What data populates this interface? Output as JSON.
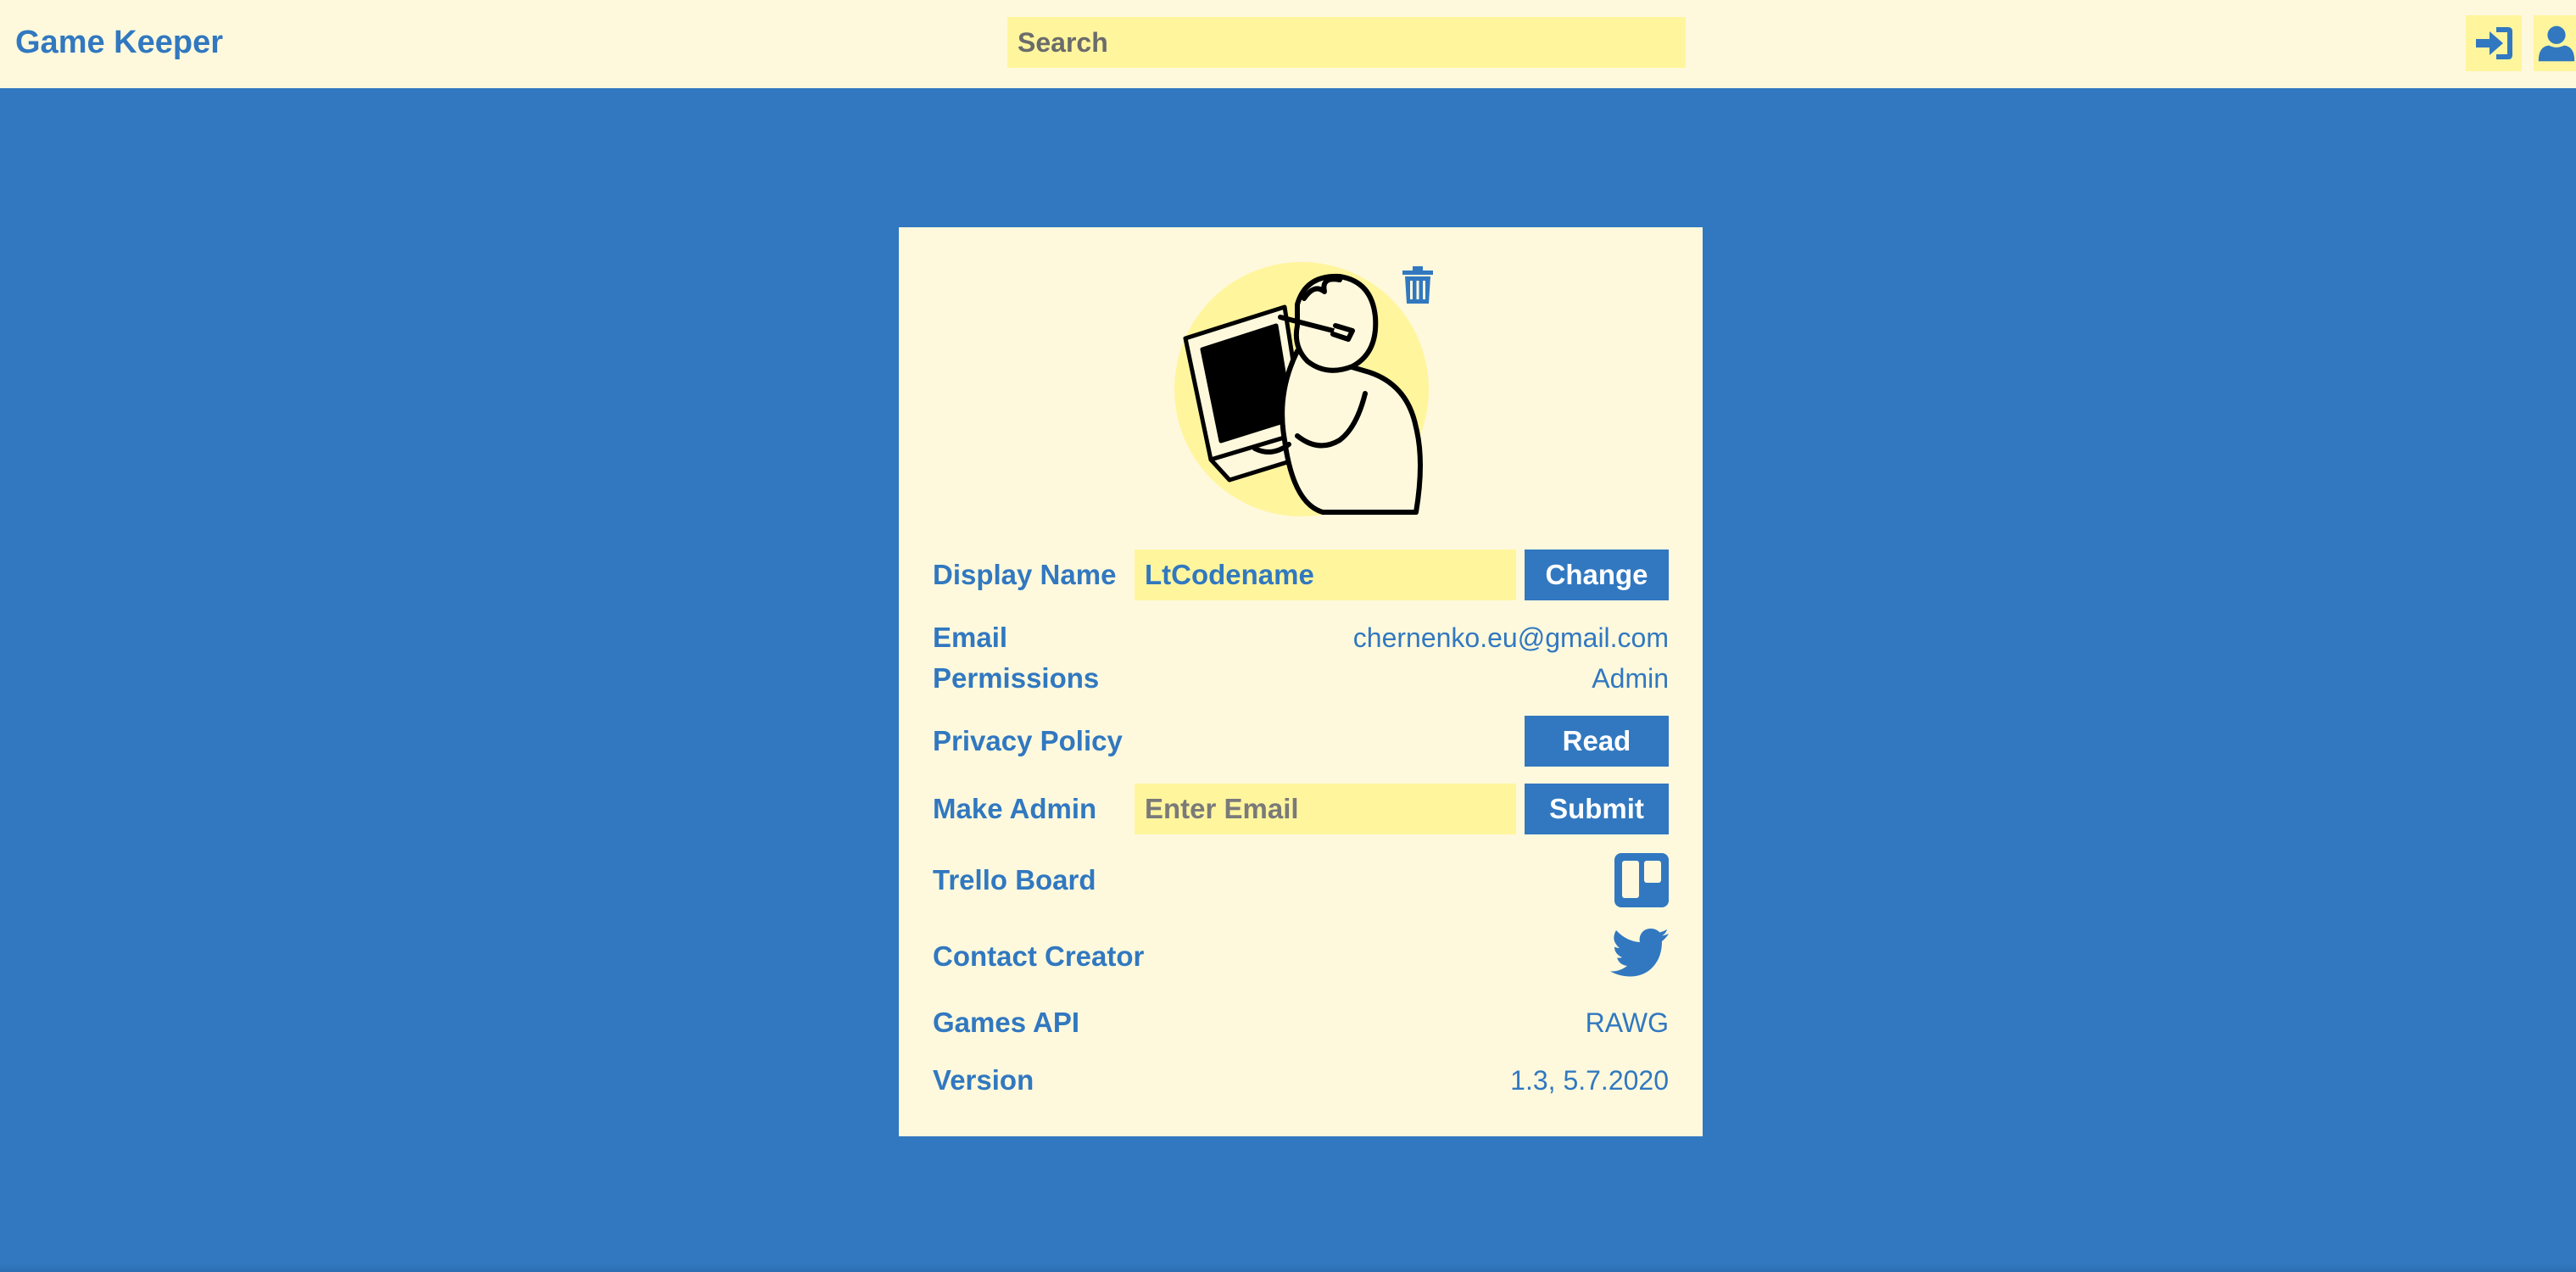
{
  "header": {
    "app_title": "Game Keeper",
    "search_placeholder": "Search",
    "login_icon": "sign-in-icon",
    "profile_icon": "user-icon"
  },
  "profile": {
    "avatar_icon": "person-at-laptop-illustration",
    "delete_icon": "trash-icon",
    "display_name_label": "Display Name",
    "display_name_value": "LtCodename",
    "change_label": "Change",
    "email_label": "Email",
    "email_value": "chernenko.eu@gmail.com",
    "permissions_label": "Permissions",
    "permissions_value": "Admin",
    "privacy_label": "Privacy Policy",
    "read_label": "Read",
    "make_admin_label": "Make Admin",
    "make_admin_placeholder": "Enter Email",
    "submit_label": "Submit",
    "trello_label": "Trello Board",
    "trello_icon": "trello-icon",
    "contact_label": "Contact Creator",
    "contact_icon": "twitter-icon",
    "api_label": "Games API",
    "api_value": "RAWG",
    "version_label": "Version",
    "version_value": "1.3, 5.7.2020"
  },
  "colors": {
    "background": "#3178c0",
    "panel": "#fef9dd",
    "input": "#fff59d",
    "accent": "#3178c0"
  }
}
